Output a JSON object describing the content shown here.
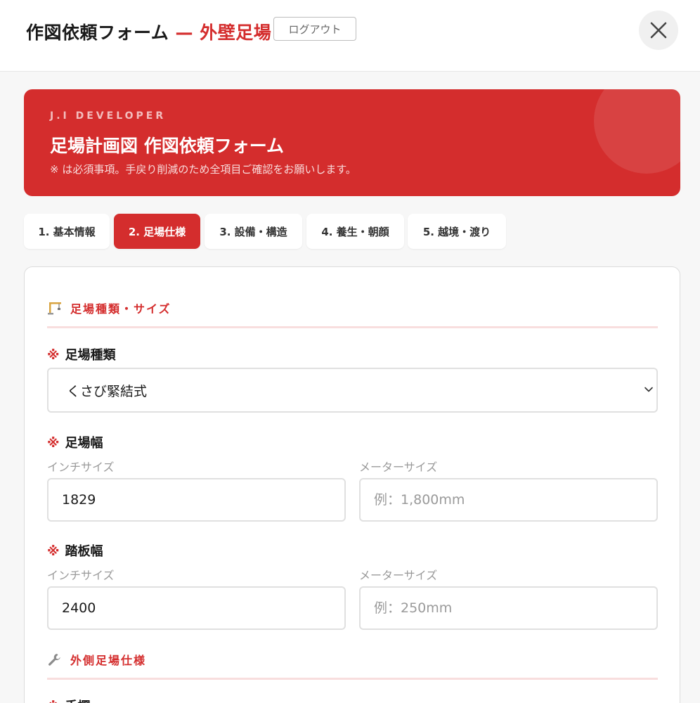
{
  "header": {
    "title_main": "作図依頼フォーム",
    "title_sep": " — ",
    "title_accent": "外壁足場",
    "logout_label": "ログアウト"
  },
  "banner": {
    "company": "J.I DEVELOPER",
    "heading": "足場計画図 作図依頼フォーム",
    "note": "※ は必須事項。手戻り削減のため全項目ご確認をお願いします。"
  },
  "tabs": [
    {
      "label": "1. 基本情報",
      "active": false
    },
    {
      "label": "2. 足場仕様",
      "active": true
    },
    {
      "label": "3. 設備・構造",
      "active": false
    },
    {
      "label": "4. 養生・朝顔",
      "active": false
    },
    {
      "label": "5. 越境・渡り",
      "active": false
    }
  ],
  "sections": {
    "size": {
      "title": "足場種類・サイズ",
      "icon": "crane-icon"
    },
    "outer": {
      "title": "外側足場仕様",
      "icon": "wrench-icon"
    }
  },
  "required_mark": "※",
  "fields": {
    "scaffold_type": {
      "label": "足場種類",
      "value": "くさび緊結式"
    },
    "scaffold_width": {
      "label": "足場幅",
      "inch_label": "インチサイズ",
      "inch_value": "1829",
      "meter_label": "メーターサイズ",
      "meter_placeholder": "例：1,800mm"
    },
    "plank_width": {
      "label": "踏板幅",
      "inch_label": "インチサイズ",
      "inch_value": "2400",
      "meter_label": "メーターサイズ",
      "meter_placeholder": "例：250mm"
    },
    "handrail": {
      "label": "手摺"
    }
  },
  "colors": {
    "accent": "#d42d2d",
    "banner_text": "#f3bdbd"
  }
}
